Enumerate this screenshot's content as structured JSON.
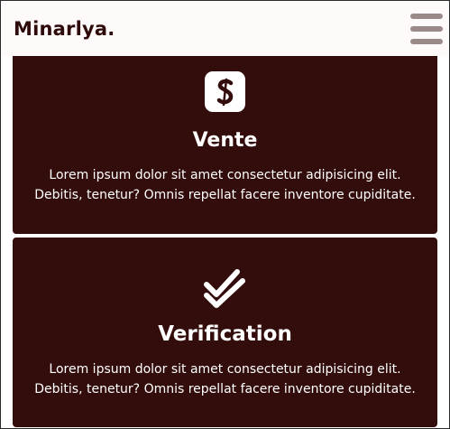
{
  "navbar": {
    "brand": "Minarlya.",
    "menu_icon": "hamburger-menu-icon"
  },
  "cards": [
    {
      "icon": "dollar-sign-icon",
      "icon_letter": "S",
      "title": "Vente",
      "text_line1": "Lorem ipsum dolor sit amet consectetur adipisicing elit.",
      "text_line2": "Debitis, tenetur? Omnis repellat facere inventore cupiditate."
    },
    {
      "icon": "double-check-icon",
      "title": "Verification",
      "text_line1": "Lorem ipsum dolor sit amet consectetur adipisicing elit.",
      "text_line2": "Debitis, tenetur? Omnis repellat facere inventore cupiditate."
    }
  ],
  "colors": {
    "card_background": "#330d0b",
    "navbar_background": "#fffafa",
    "brand_text": "#2e0a0a",
    "menu_icon": "#9b8a8a"
  }
}
